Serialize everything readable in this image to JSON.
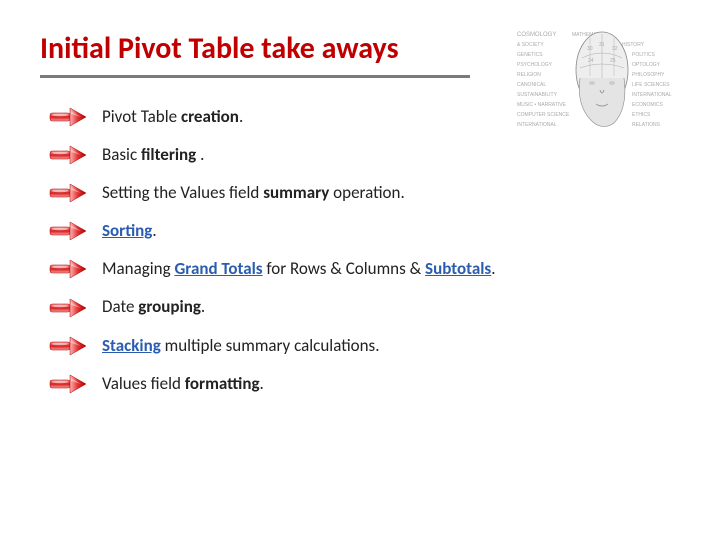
{
  "title": "Initial Pivot Table take aways",
  "bullets": [
    {
      "parts": [
        {
          "text": "Pivot Table ",
          "style": ""
        },
        {
          "text": "creation",
          "style": "bold"
        },
        {
          "text": ".",
          "style": ""
        }
      ]
    },
    {
      "parts": [
        {
          "text": "Basic ",
          "style": ""
        },
        {
          "text": "filtering",
          "style": "bold"
        },
        {
          "text": " .",
          "style": ""
        }
      ]
    },
    {
      "parts": [
        {
          "text": "Setting the Values field ",
          "style": ""
        },
        {
          "text": "summary",
          "style": "bold"
        },
        {
          "text": " operation.",
          "style": ""
        }
      ]
    },
    {
      "parts": [
        {
          "text": "Sorting",
          "style": "link"
        },
        {
          "text": ".",
          "style": ""
        }
      ]
    },
    {
      "parts": [
        {
          "text": "Managing ",
          "style": ""
        },
        {
          "text": "Grand Totals",
          "style": "link"
        },
        {
          "text": " for Rows & Columns & ",
          "style": ""
        },
        {
          "text": "Subtotals",
          "style": "link"
        },
        {
          "text": ".",
          "style": ""
        }
      ]
    },
    {
      "parts": [
        {
          "text": "Date ",
          "style": ""
        },
        {
          "text": "grouping",
          "style": "bold"
        },
        {
          "text": ".",
          "style": ""
        }
      ]
    },
    {
      "parts": [
        {
          "text": "Stacking",
          "style": "link"
        },
        {
          "text": " multiple summary calculations.",
          "style": ""
        }
      ]
    },
    {
      "parts": [
        {
          "text": "Values field ",
          "style": ""
        },
        {
          "text": "formatting",
          "style": "bold"
        },
        {
          "text": ".",
          "style": ""
        }
      ]
    }
  ]
}
